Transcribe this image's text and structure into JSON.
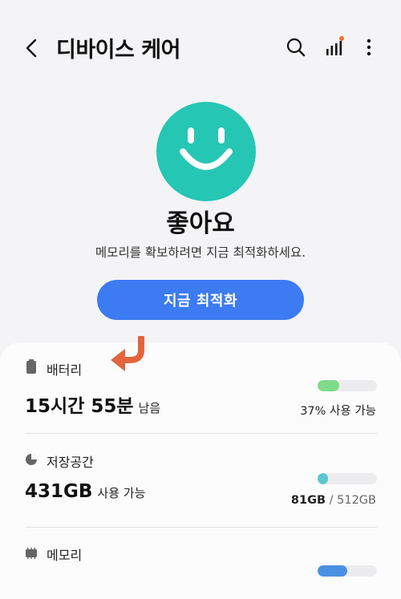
{
  "header": {
    "title": "디바이스 케어",
    "icons": [
      "back-arrow-icon",
      "search-icon",
      "signal-bars-icon",
      "more-options-icon"
    ],
    "notification_dot_color": "#e8742e"
  },
  "status": {
    "label": "좋아요",
    "message": "메모리를 확보하려면 지금 최적화하세요.",
    "smiley_color": "#26c6b4"
  },
  "optimize_button": {
    "label": "지금 최적화",
    "color": "#3c7bf2"
  },
  "battery": {
    "label": "배터리",
    "time_value": "15시간 55분",
    "time_suffix": "남음",
    "percent_text": "37% 사용 가능",
    "percent": 37,
    "bar_color": "#7edb8a"
  },
  "storage": {
    "label": "저장공간",
    "value": "431GB",
    "suffix": "사용 가능",
    "used": "81GB",
    "total": " / 512GB",
    "used_fraction": 0.158,
    "bar_color": "#5cc7cf"
  },
  "memory": {
    "label": "메모리",
    "bar_color": "#4a90e2"
  },
  "annotation": {
    "arrow_color": "#e2653c"
  }
}
